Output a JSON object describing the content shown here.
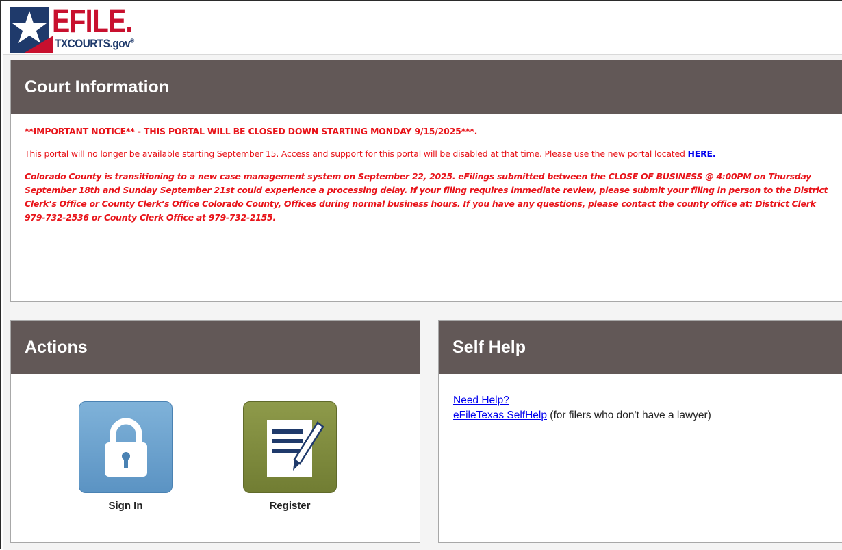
{
  "logo": {
    "word": "EFILE.",
    "sub": "TXCOURTS.gov",
    "tm": "®"
  },
  "court_info": {
    "title": "Court Information",
    "notice_headline": "**IMPORTANT NOTICE** - THIS PORTAL WILL BE CLOSED DOWN STARTING MONDAY 9/15/2025***.",
    "notice_body": "This portal will no longer be available starting September 15. Access and support for this portal will be disabled at that time. Please use the new portal located ",
    "notice_link": "HERE.",
    "transition_notice": "Colorado County is transitioning to a new case management system on September 22, 2025. eFilings submitted between the CLOSE OF BUSINESS @ 4:00PM on Thursday September 18th and Sunday September 21st could experience a processing delay. If your filing requires immediate review, please submit your filing in person to the District Clerk’s Office or County Clerk’s Office Colorado County, Offices during normal business hours. If you have any questions, please contact the county office at: District Clerk 979-732-2536 or County Clerk Office at 979-732-2155."
  },
  "actions": {
    "title": "Actions",
    "sign_in_label": "Sign In",
    "register_label": "Register",
    "sign_in_icon": "lock-icon",
    "register_icon": "document-pen-icon"
  },
  "self_help": {
    "title": "Self Help",
    "need_help_link": "Need Help?",
    "selfhelp_link": "eFileTexas SelfHelp",
    "selfhelp_note": " (for filers who don't have a lawyer)"
  },
  "colors": {
    "header_bg": "#625857",
    "notice_red": "#e8141a",
    "brand_red": "#c8102e",
    "brand_blue": "#1f3a6b",
    "signin_tile": "#6aa2cf",
    "register_tile": "#7f8b3e"
  }
}
